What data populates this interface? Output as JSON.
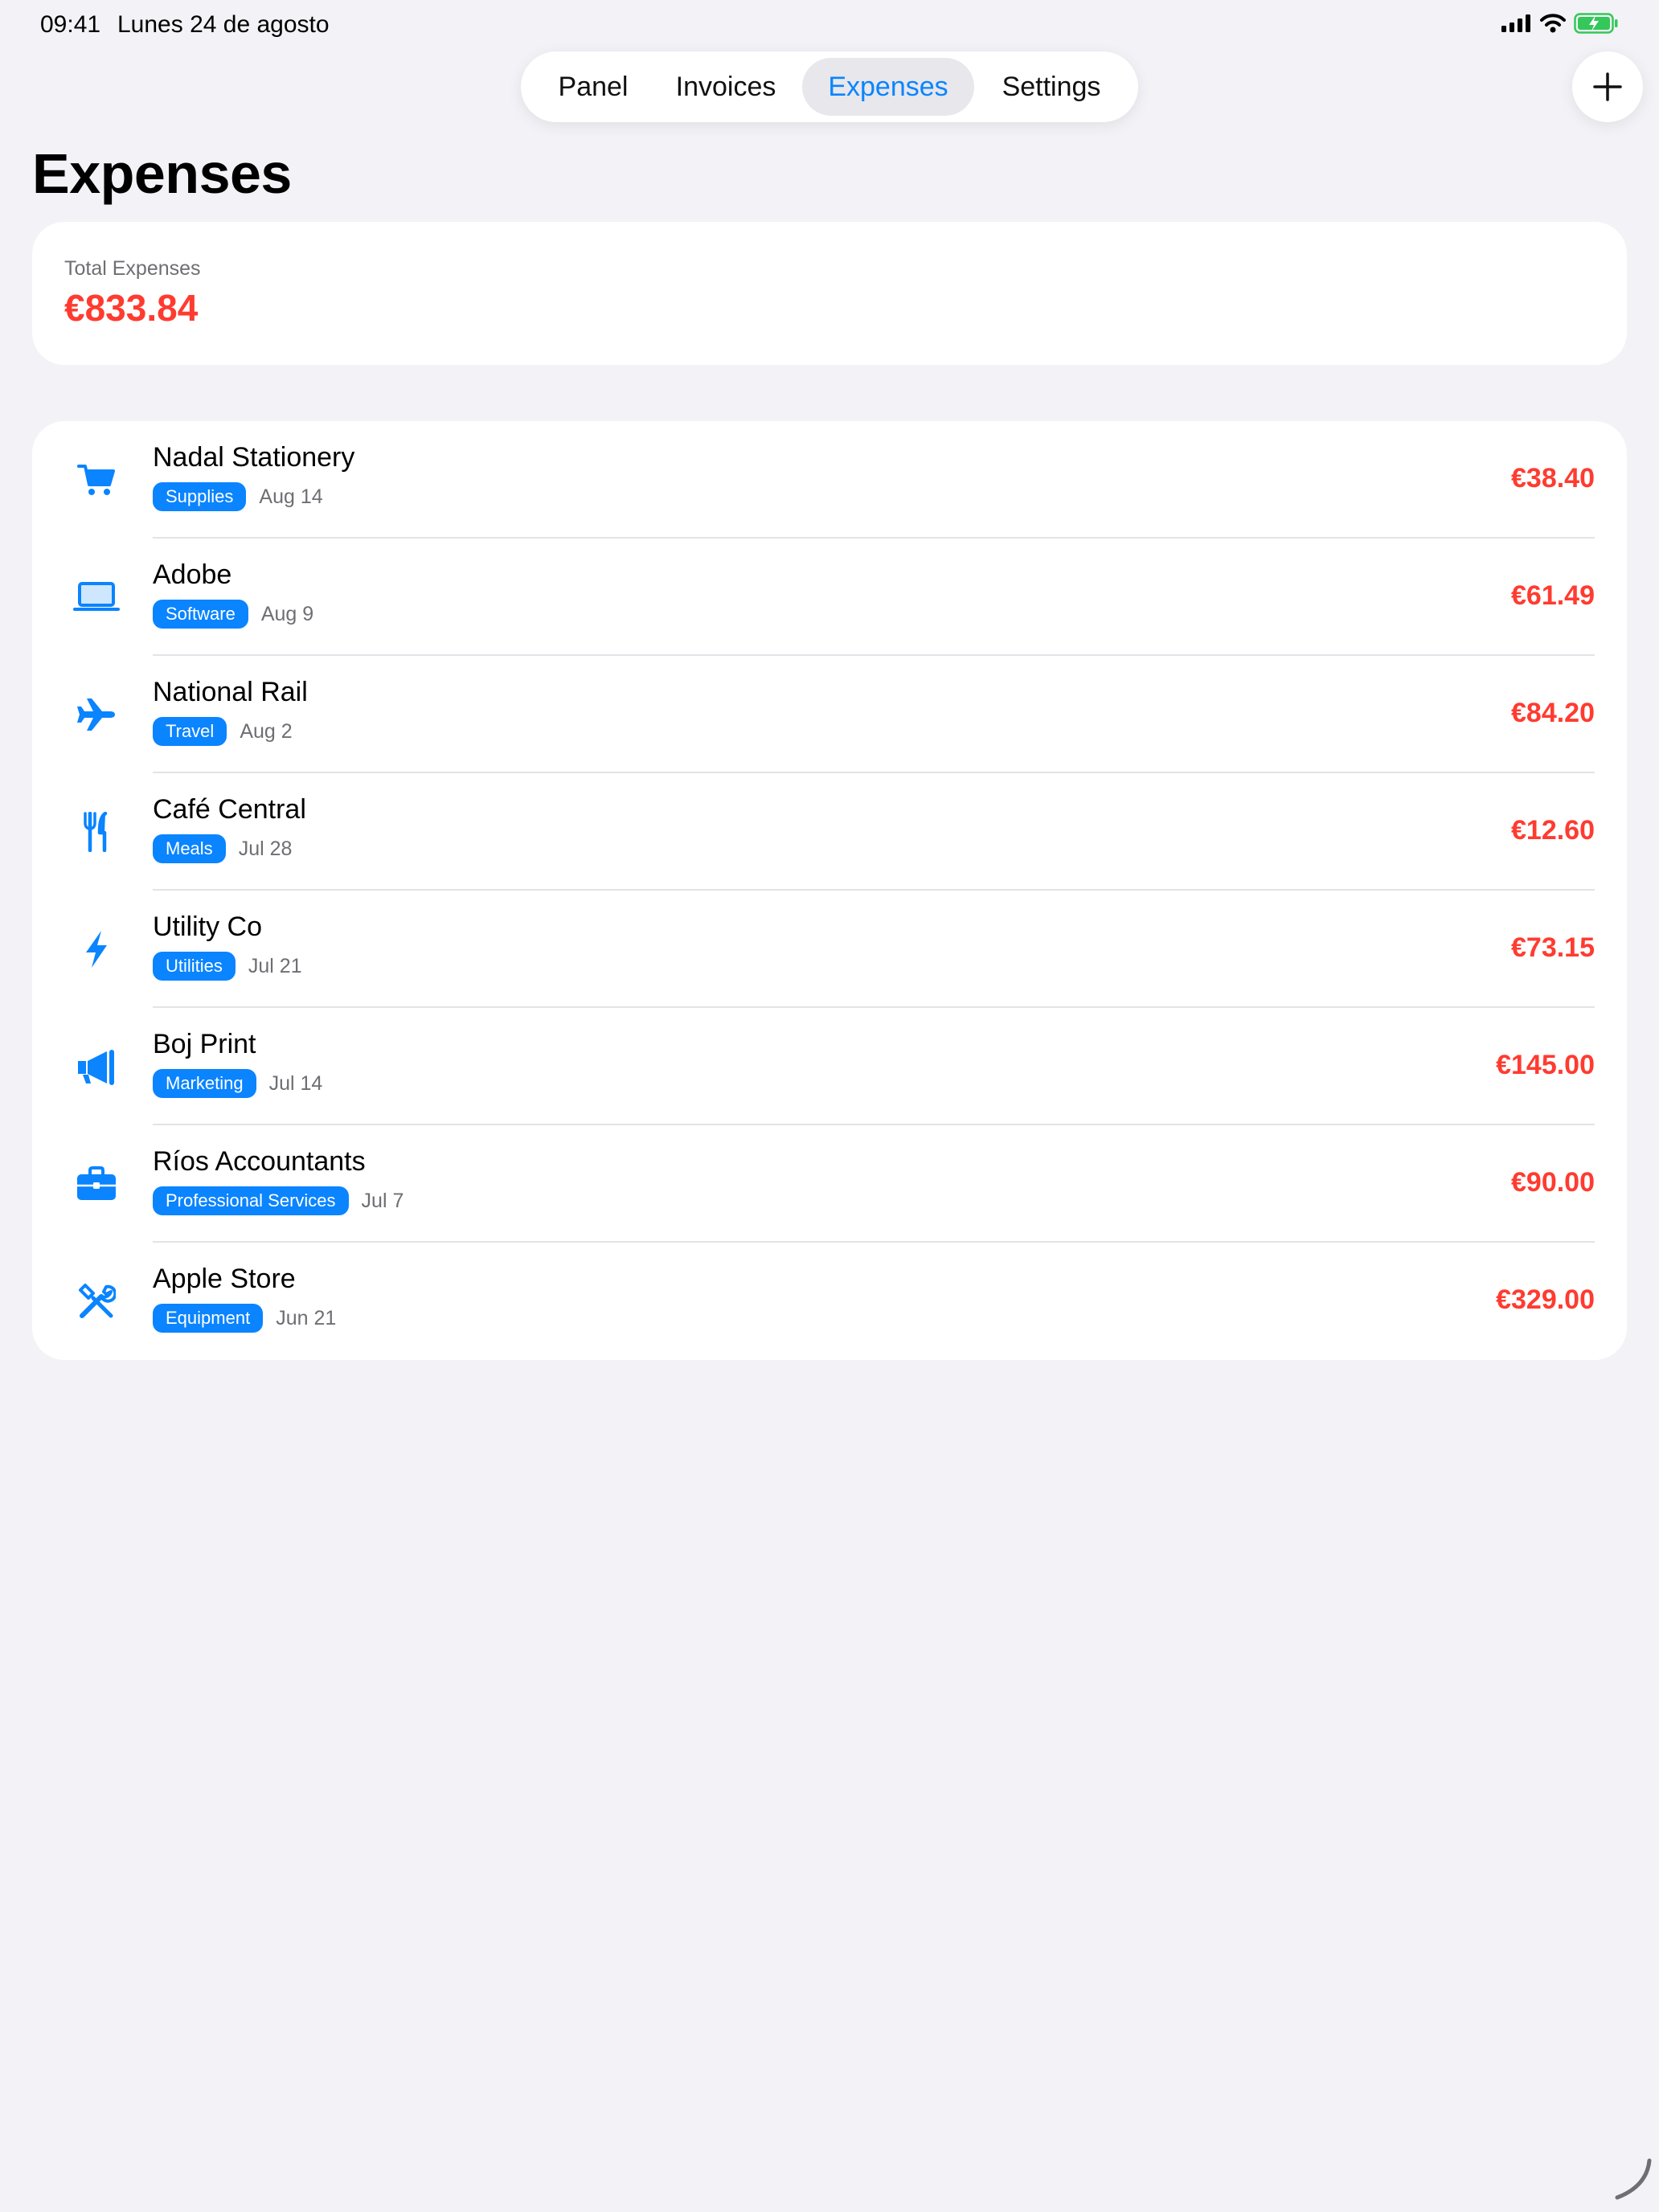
{
  "status_bar": {
    "time": "09:41",
    "date": "Lunes 24 de agosto"
  },
  "tabs": [
    {
      "label": "Panel",
      "active": false
    },
    {
      "label": "Invoices",
      "active": false
    },
    {
      "label": "Expenses",
      "active": true
    },
    {
      "label": "Settings",
      "active": false
    }
  ],
  "page": {
    "title": "Expenses"
  },
  "summary": {
    "label": "Total Expenses",
    "value": "€833.84"
  },
  "expenses": [
    {
      "name": "Nadal Stationery",
      "category": "Supplies",
      "date": "Aug 14",
      "amount": "€38.40",
      "icon": "cart-icon"
    },
    {
      "name": "Adobe",
      "category": "Software",
      "date": "Aug 9",
      "amount": "€61.49",
      "icon": "laptop-icon"
    },
    {
      "name": "National Rail",
      "category": "Travel",
      "date": "Aug 2",
      "amount": "€84.20",
      "icon": "airplane-icon"
    },
    {
      "name": "Café Central",
      "category": "Meals",
      "date": "Jul 28",
      "amount": "€12.60",
      "icon": "fork-knife-icon"
    },
    {
      "name": "Utility Co",
      "category": "Utilities",
      "date": "Jul 21",
      "amount": "€73.15",
      "icon": "bolt-icon"
    },
    {
      "name": "Boj Print",
      "category": "Marketing",
      "date": "Jul 14",
      "amount": "€145.00",
      "icon": "megaphone-icon"
    },
    {
      "name": "Ríos Accountants",
      "category": "Professional Services",
      "date": "Jul 7",
      "amount": "€90.00",
      "icon": "briefcase-icon"
    },
    {
      "name": "Apple Store",
      "category": "Equipment",
      "date": "Jun 21",
      "amount": "€329.00",
      "icon": "tools-icon"
    }
  ],
  "colors": {
    "accent": "#0a84ff",
    "negative": "#ff3b30",
    "background": "#f2f2f7",
    "card": "#ffffff"
  }
}
